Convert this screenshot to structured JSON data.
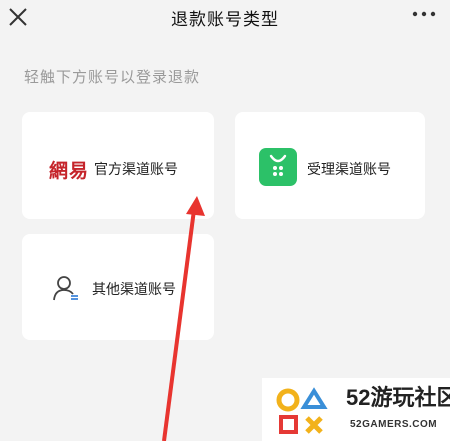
{
  "header": {
    "title": "退款账号类型",
    "close_icon": "close-icon",
    "more_icon": "more-icon"
  },
  "hint": "轻触下方账号以登录退款",
  "cards": {
    "official": {
      "logo_text": "網易",
      "label": "官方渠道账号"
    },
    "agent": {
      "label": "受理渠道账号",
      "icon": "app-store-bag-icon"
    },
    "other": {
      "label": "其他渠道账号",
      "icon": "person-swap-icon"
    }
  },
  "watermark": {
    "number": "52",
    "name": "游玩社区",
    "url": "52GAMERS.COM"
  },
  "colors": {
    "background": "#f3f3f3",
    "card": "#ffffff",
    "netease_red": "#c5242a",
    "agent_green": "#2cc168",
    "arrow_red": "#e8342f"
  }
}
